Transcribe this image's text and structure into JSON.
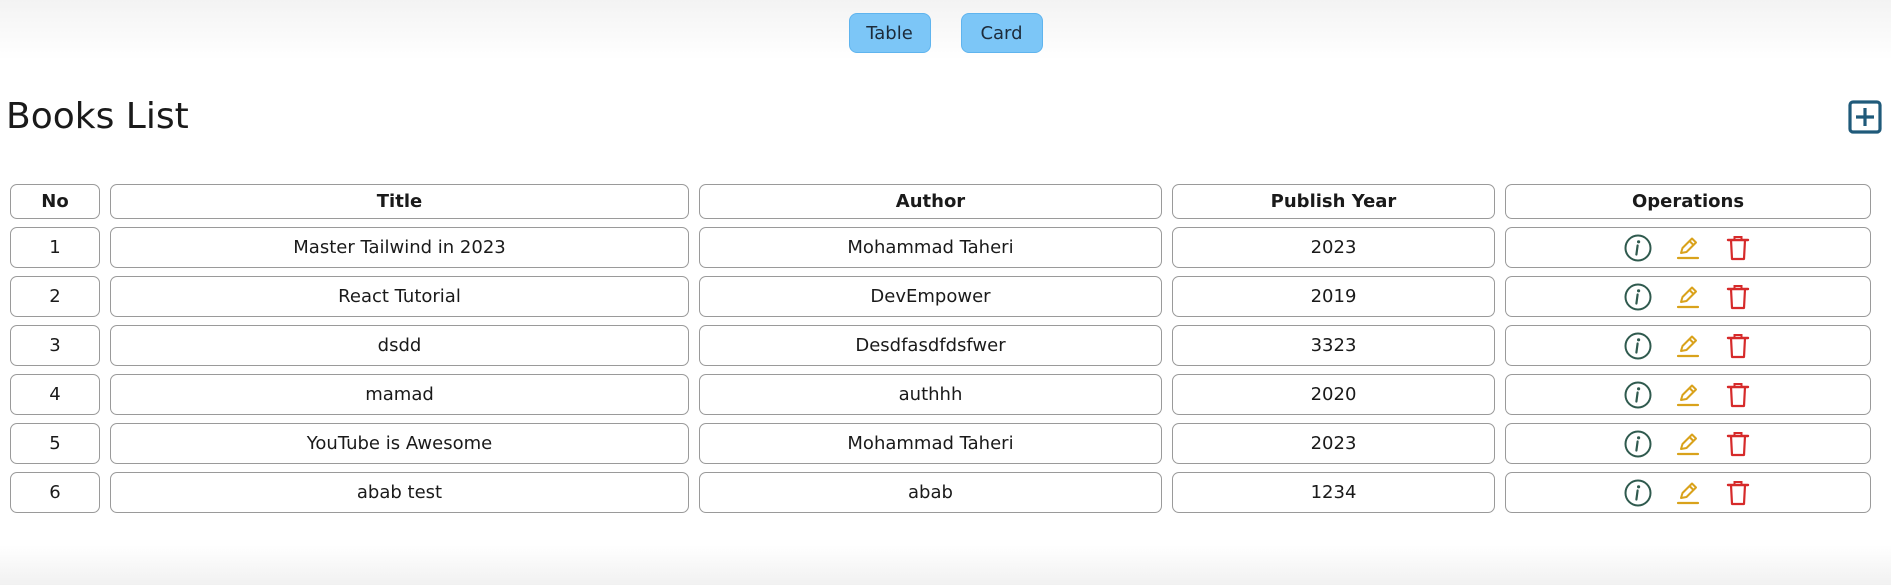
{
  "view_toggle": {
    "table_label": "Table",
    "card_label": "Card"
  },
  "page": {
    "title": "Books List"
  },
  "table": {
    "headers": [
      "No",
      "Title",
      "Author",
      "Publish Year",
      "Operations"
    ],
    "rows": [
      {
        "no": "1",
        "title": "Master Tailwind in 2023",
        "author": "Mohammad Taheri",
        "year": "2023"
      },
      {
        "no": "2",
        "title": "React Tutorial",
        "author": "DevEmpower",
        "year": "2019"
      },
      {
        "no": "3",
        "title": "dsdd",
        "author": "Desdfasdfdsfwer",
        "year": "3323"
      },
      {
        "no": "4",
        "title": "mamad",
        "author": "authhh",
        "year": "2020"
      },
      {
        "no": "5",
        "title": "YouTube is Awesome",
        "author": "Mohammad Taheri",
        "year": "2023"
      },
      {
        "no": "6",
        "title": "abab test",
        "author": "abab",
        "year": "1234"
      }
    ]
  },
  "icons": {
    "add": "plus-square-icon",
    "info": "info-circle-icon",
    "edit": "pencil-icon",
    "delete": "trash-icon"
  },
  "colors": {
    "toggle_bg": "#7cc6f7",
    "add_icon": "#1f5a7a",
    "info_icon": "#2f5a4e",
    "edit_icon": "#d9a21b",
    "delete_icon": "#d62a2a"
  }
}
